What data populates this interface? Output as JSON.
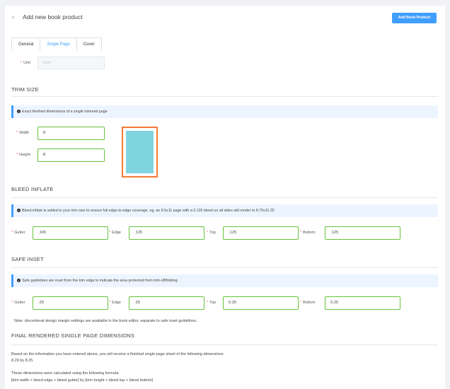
{
  "header": {
    "back_icon": "chevron-left-icon",
    "title": "Add new book product",
    "add_button": "Add Book Product"
  },
  "tabs": [
    {
      "label": "General",
      "active": false
    },
    {
      "label": "Single Page",
      "active": true
    },
    {
      "label": "Cover",
      "active": false
    }
  ],
  "unit": {
    "label": "Unit",
    "placeholder": "inch"
  },
  "trim": {
    "heading": "TRIM SIZE",
    "info": "Exact finished dimensions of a single trimmed page",
    "width_label": "Width",
    "width_value": "8",
    "height_label": "Height",
    "height_value": "8"
  },
  "bleed": {
    "heading": "BLEED INFLATE",
    "info": "Bleed inflate is added to your trim size to ensure full edge-to-edge coverage. eg. an 8.5x11 page with a 0.125 bleed on all sides will render to 8.75x11.25",
    "gutter_label": "Gutter",
    "gutter_value": ".165",
    "edge_label": "Edge",
    "edge_value": ".125",
    "top_label": "Top",
    "top_value": ".125",
    "bottom_label": "Bottom",
    "bottom_value": ".125"
  },
  "safe": {
    "heading": "SAFE INSET",
    "info": "Safe guidelines are inset from the trim edge to indicate the area protected from trim-off/folding.",
    "gutter_label": "Gutter",
    "gutter_value": ".25",
    "edge_label": "Edge",
    "edge_value": ".25",
    "top_label": "Top",
    "top_value": "0.25",
    "bottom_label": "Bottom",
    "bottom_value": "0.25",
    "note": "Note: discretional design margin settings are available in the book editor, separate to safe inset guidelines."
  },
  "final": {
    "heading": "FINAL RENDERED SINGLE PAGE DIMENSIONS",
    "line1": "Based on the information you have entered above, you will receive a finished single page sheet of the following dimensions:",
    "line2": "8.29 by 8.25",
    "line3": "These dimensions were calculated using the following formula:",
    "line4": "[trim width + bleed edge + bleed gutter] by [trim height + bleed top + bleed bottom]"
  },
  "colors": {
    "accent": "#409eff",
    "valid_border": "#67c23a",
    "preview_border": "#f47a36",
    "preview_fill": "#7fd4e0"
  }
}
